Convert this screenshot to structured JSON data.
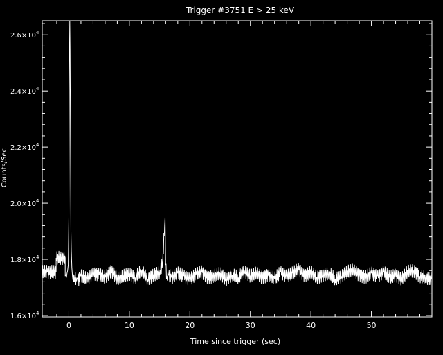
{
  "chart_data": {
    "type": "line",
    "title": "Trigger #3751  E > 25 keV",
    "xlabel": "Time since trigger (sec)",
    "ylabel": "Counts/Sec",
    "xlim": [
      -4.4,
      60
    ],
    "ylim": [
      15950,
      26500
    ],
    "xticks": [
      0,
      10,
      20,
      30,
      40,
      50
    ],
    "xtick_labels": [
      "0",
      "10",
      "20",
      "30",
      "40",
      "50"
    ],
    "yticks": [
      16000,
      18000,
      20000,
      22000,
      24000,
      26000
    ],
    "ytick_labels": [
      {
        "mantissa": "1.6",
        "exp": "4"
      },
      {
        "mantissa": "1.8",
        "exp": "4"
      },
      {
        "mantissa": "2.0",
        "exp": "4"
      },
      {
        "mantissa": "2.2",
        "exp": "4"
      },
      {
        "mantissa": "2.4",
        "exp": "4"
      },
      {
        "mantissa": "2.6",
        "exp": "4"
      }
    ],
    "grid": false,
    "colors": {
      "background": "#000000",
      "foreground": "#ffffff"
    },
    "series": [
      {
        "step": 0.064,
        "x": [
          -4.4,
          -3.6,
          -3.6,
          -2.1,
          -2.1,
          -0.6,
          -0.6,
          -0.5,
          -0.4,
          -0.3,
          -0.2,
          -0.1,
          0.0,
          0.05,
          0.1,
          0.15,
          0.2,
          0.25,
          0.3,
          0.35,
          0.4,
          0.5,
          0.6,
          0.8,
          1.0,
          1.2,
          1.5,
          2,
          3,
          4,
          5,
          6,
          7,
          8,
          9,
          10,
          11,
          12,
          13,
          14,
          15,
          15.5,
          15.9,
          16.0,
          16.2,
          16.5,
          17,
          18,
          19,
          20,
          21,
          22,
          23,
          24,
          25,
          26,
          27,
          28,
          29,
          30,
          31,
          32,
          33,
          34,
          35,
          36,
          37,
          38,
          39,
          40,
          41,
          42,
          43,
          44,
          45,
          46,
          47,
          48,
          49,
          50,
          51,
          52,
          53,
          54,
          55,
          56,
          57,
          58,
          59,
          59.9
        ],
        "y": [
          17550,
          17550,
          17550,
          17550,
          18050,
          18050,
          17400,
          17450,
          17350,
          17500,
          17600,
          17800,
          19500,
          22500,
          25200,
          26500,
          25500,
          23000,
          21000,
          19000,
          18300,
          17700,
          17400,
          17200,
          17300,
          17350,
          17250,
          17400,
          17300,
          17500,
          17450,
          17350,
          17600,
          17300,
          17400,
          17500,
          17350,
          17600,
          17300,
          17450,
          17500,
          17900,
          19500,
          17800,
          17400,
          17450,
          17350,
          17500,
          17400,
          17300,
          17450,
          17550,
          17350,
          17400,
          17500,
          17300,
          17450,
          17350,
          17600,
          17400,
          17500,
          17350,
          17450,
          17300,
          17550,
          17400,
          17500,
          17650,
          17400,
          17550,
          17350,
          17450,
          17500,
          17300,
          17400,
          17550,
          17600,
          17450,
          17350,
          17500,
          17400,
          17550,
          17350,
          17450,
          17300,
          17550,
          17600,
          17400,
          17350,
          17300
        ]
      }
    ]
  }
}
